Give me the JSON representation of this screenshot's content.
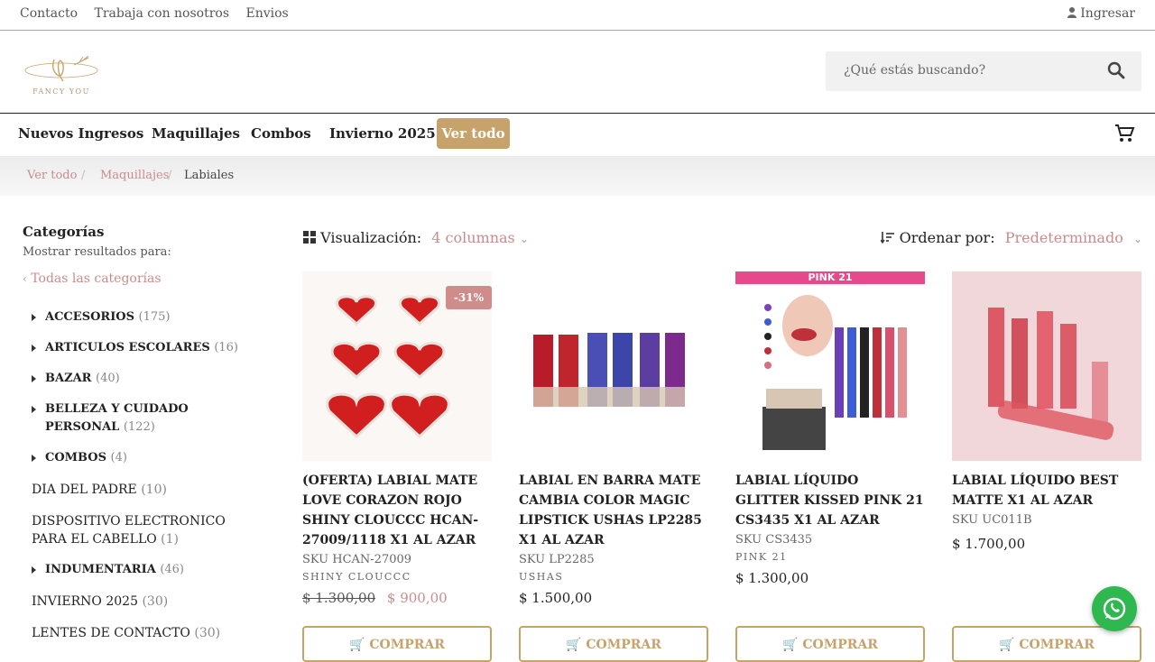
{
  "topbar": {
    "links": [
      "Contacto",
      "Trabaja con nosotros",
      "Envios"
    ],
    "login": "Ingresar"
  },
  "brand": {
    "logo_text": "FANCY YOU"
  },
  "search": {
    "placeholder": "¿Qué estás buscando?"
  },
  "nav": {
    "items": [
      "Nuevos Ingresos",
      "Maquillajes",
      "Combos",
      "Invierno 2025"
    ],
    "cta": "Ver todo"
  },
  "breadcrumb": [
    "Ver todo",
    "Maquillajes",
    "Labiales"
  ],
  "sidebar": {
    "heading": "Categorías",
    "subheading": "Mostrar resultados para:",
    "all_label": "Todas las categorías",
    "categories": [
      {
        "name": "ACCESORIOS",
        "count": "(175)"
      },
      {
        "name": "ARTICULOS ESCOLARES",
        "count": "(16)"
      },
      {
        "name": "BAZAR",
        "count": "(40)"
      },
      {
        "name": "BELLEZA Y CUIDADO PERSONAL",
        "count": "(122)"
      },
      {
        "name": "COMBOS",
        "count": "(4)"
      },
      {
        "name": "DIA DEL PADRE",
        "count": "(10)"
      },
      {
        "name": "DISPOSITIVO ELECTRONICO PARA EL CABELLO",
        "count": "(1)"
      },
      {
        "name": "INDUMENTARIA",
        "count": "(46)"
      },
      {
        "name": "INVIERNO 2025",
        "count": "(30)"
      },
      {
        "name": "LENTES DE CONTACTO",
        "count": "(30)"
      }
    ]
  },
  "toolbar": {
    "view_label": "Visualización:",
    "view_value": "4 columnas",
    "sort_label": "Ordenar por:",
    "sort_value": "Predeterminado"
  },
  "products": [
    {
      "title": "(OFERTA) LABIAL MATE LOVE CORAZON ROJO SHINY CLOUCCC HCAN-27009/1118 X1 AL AZAR",
      "sku": "SKU HCAN-27009",
      "brand": "SHINY CLOUCCC",
      "old_price": "$ 1.300,00",
      "price": "$ 900,00",
      "badge": "-31%",
      "button": "COMPRAR"
    },
    {
      "title": "LABIAL EN BARRA MATE CAMBIA COLOR MAGIC LIPSTICK USHAS LP2285 X1 AL AZAR",
      "sku": "SKU LP2285",
      "brand": "USHAS",
      "price": "$ 1.500,00",
      "button": "COMPRAR"
    },
    {
      "title": "LABIAL LÍQUIDO GLITTER KISSED PINK 21 CS3435 X1 AL AZAR",
      "sku": "SKU CS3435",
      "brand": "PINK 21",
      "price": "$ 1.300,00",
      "banner": "PINK 21",
      "button": "COMPRAR"
    },
    {
      "title": "LABIAL LÍQUIDO BEST MATTE X1 AL AZAR",
      "sku": "SKU UC011B",
      "price": "$ 1.700,00",
      "button": "COMPRAR"
    }
  ],
  "colors": {
    "accent": "#c8a26b",
    "link": "#c98c8c",
    "whatsapp": "#2fb84f"
  }
}
